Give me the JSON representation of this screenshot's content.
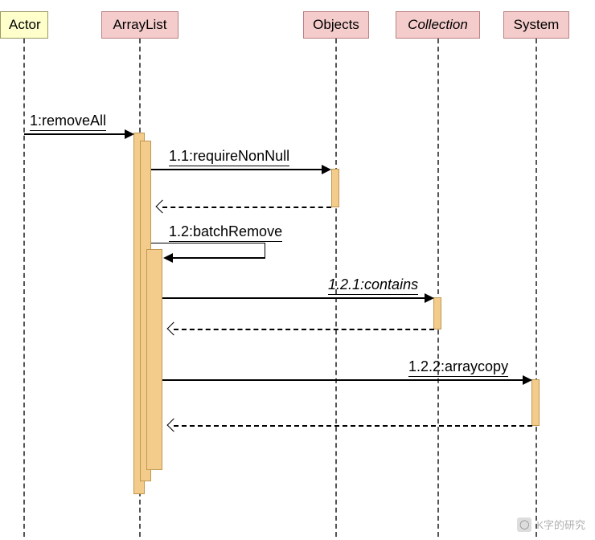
{
  "participants": {
    "actor": {
      "label": "Actor"
    },
    "arraylist": {
      "label": "ArrayList"
    },
    "objects": {
      "label": "Objects"
    },
    "collection": {
      "label": "Collection"
    },
    "system": {
      "label": "System"
    }
  },
  "messages": {
    "m1": {
      "label": "1:removeAll"
    },
    "m1_1": {
      "label": "1.1:requireNonNull"
    },
    "m1_2": {
      "label": "1.2:batchRemove"
    },
    "m1_2_1": {
      "label": "1.2.1:contains"
    },
    "m1_2_2": {
      "label": "1.2.2:arraycopy"
    }
  },
  "watermark": {
    "text": "K字的研究"
  }
}
